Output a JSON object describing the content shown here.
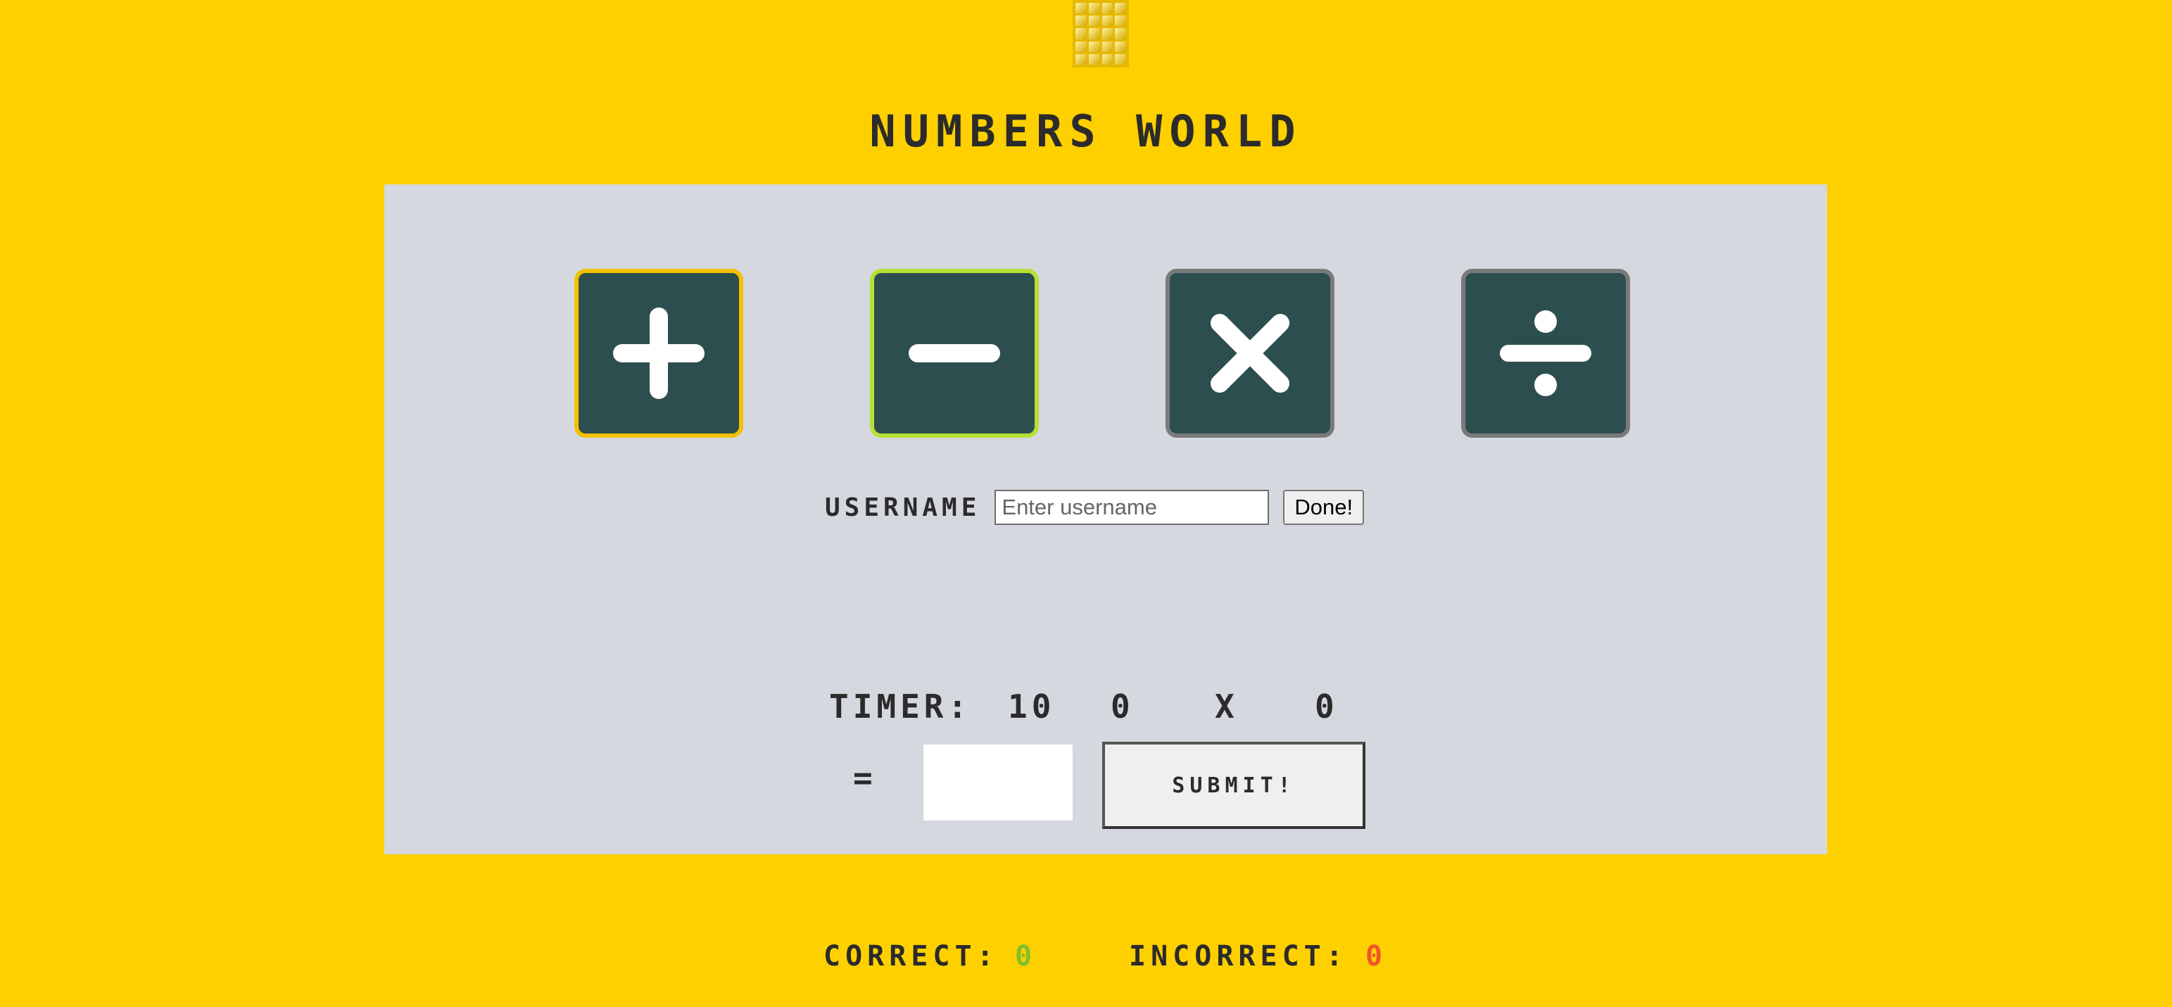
{
  "header": {
    "logo_icon": "calculator-keypad-logo",
    "title": "NUMBERS WORLD"
  },
  "operations": [
    {
      "name": "addition",
      "icon": "plus-icon",
      "selected_border": "#f2c200"
    },
    {
      "name": "subtraction",
      "icon": "minus-icon",
      "selected_border": "#b6e036"
    },
    {
      "name": "multiplication",
      "icon": "times-icon"
    },
    {
      "name": "division",
      "icon": "divide-icon"
    }
  ],
  "user": {
    "label": "USERNAME",
    "placeholder": "Enter username",
    "value": "",
    "done_label": "Done!"
  },
  "game": {
    "timer_label": "TIMER:",
    "timer_value": "10",
    "operand1": "0",
    "operator": "X",
    "operand2": "0",
    "equals": "=",
    "answer_value": "",
    "submit_label": "SUBMIT!"
  },
  "score": {
    "correct_label": "CORRECT:",
    "correct_value": "0",
    "incorrect_label": "INCORRECT:",
    "incorrect_value": "0"
  },
  "colors": {
    "background": "#ffd000",
    "panel": "#d5d8de",
    "tile": "#2d4e4f",
    "correct": "#7fbf2a",
    "incorrect": "#f0552a"
  }
}
